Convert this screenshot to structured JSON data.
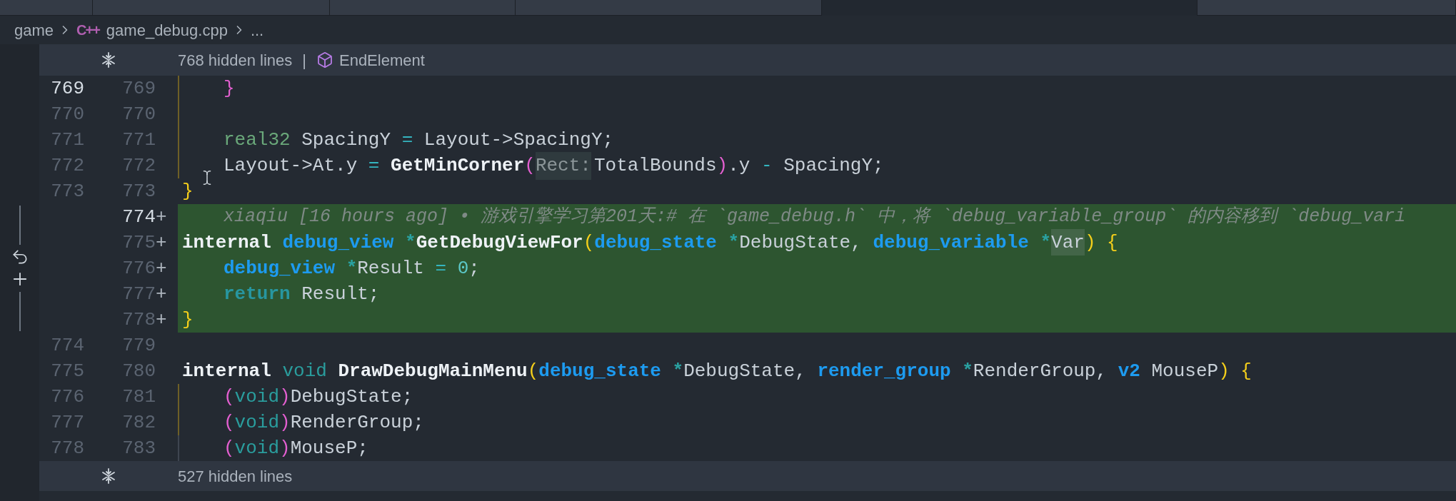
{
  "tabs": [
    {
      "selected": false
    },
    {
      "selected": false
    },
    {
      "selected": false
    },
    {
      "selected": false
    },
    {
      "selected": true
    },
    {
      "selected": false
    }
  ],
  "breadcrumb": {
    "folder": "game",
    "file_icon": "C++",
    "file": "game_debug.cpp",
    "symbol": "..."
  },
  "hidden_top": {
    "label": "768 hidden lines",
    "separator": "|",
    "symbol": "EndElement"
  },
  "lines": [
    {
      "old": {
        "text": "769",
        "active": true
      },
      "new": {
        "text": "769",
        "active": false
      },
      "added": false,
      "indented": true,
      "guide": true,
      "tokens": [
        {
          "text": "}",
          "kind": "paren_pink"
        }
      ]
    },
    {
      "old": {
        "text": "770",
        "active": false
      },
      "new": {
        "text": "770",
        "active": false
      },
      "added": false,
      "guide": true
    },
    {
      "old": {
        "text": "771",
        "active": false
      },
      "new": {
        "text": "771",
        "active": false
      },
      "added": false,
      "indented": true,
      "guide": true,
      "tokens": [
        {
          "text": "real32",
          "kind": "type"
        },
        {
          "text": " SpacingY ",
          "kind": "plain"
        },
        {
          "text": "=",
          "kind": "op"
        },
        {
          "text": " Layout->SpacingY;",
          "kind": "plain"
        }
      ]
    },
    {
      "old": {
        "text": "772",
        "active": false
      },
      "new": {
        "text": "772",
        "active": false
      },
      "added": false,
      "indented": true,
      "guide": true,
      "tokens": [
        {
          "text": "Layout->At.y ",
          "kind": "plain"
        },
        {
          "text": "= ",
          "kind": "op"
        },
        {
          "text": "GetMinCorner",
          "kind": "func"
        },
        {
          "text": "(",
          "kind": "paren_pink"
        },
        {
          "text": "Rect:",
          "kind": "hint"
        },
        {
          "text": "TotalBounds",
          "kind": "plain"
        },
        {
          "text": ")",
          "kind": "paren_pink"
        },
        {
          "text": ".y ",
          "kind": "plain"
        },
        {
          "text": "-",
          "kind": "op"
        },
        {
          "text": " SpacingY;",
          "kind": "plain"
        }
      ]
    },
    {
      "old": {
        "text": "773",
        "active": false
      },
      "new": {
        "text": "773",
        "active": false
      },
      "added": false,
      "indented": false,
      "pointer": true,
      "tokens": [
        {
          "text": "}",
          "kind": "paren_yellow"
        }
      ]
    },
    {
      "new": {
        "text": "774",
        "active": true
      },
      "marker": "+",
      "added": true,
      "indented": true,
      "tokens": [
        {
          "text": "xiaqiu [16 hours ago] • 游戏引擎学习第201天:# 在 `game_debug.h` 中，将 `debug_variable_group` 的内容移到 `debug_vari",
          "kind": "blame"
        }
      ]
    },
    {
      "new": {
        "text": "775",
        "active": false
      },
      "marker": "+",
      "added": true,
      "indented": false,
      "tokens": [
        {
          "text": "internal ",
          "kind": "keyword"
        },
        {
          "text": "debug_view ",
          "kind": "type_strong"
        },
        {
          "text": "*",
          "kind": "star"
        },
        {
          "text": "GetDebugViewFor",
          "kind": "func"
        },
        {
          "text": "(",
          "kind": "paren_yellow"
        },
        {
          "text": "debug_state ",
          "kind": "type_strong"
        },
        {
          "text": "*",
          "kind": "star"
        },
        {
          "text": "DebugState, ",
          "kind": "plain"
        },
        {
          "text": "debug_variable ",
          "kind": "type_strong"
        },
        {
          "text": "*",
          "kind": "star"
        },
        {
          "text": "Var",
          "kind": "highlight"
        },
        {
          "text": ") {",
          "kind": "paren_yellow"
        }
      ]
    },
    {
      "new": {
        "text": "776",
        "active": false
      },
      "marker": "+",
      "added": true,
      "indented": true,
      "tokens": [
        {
          "text": "debug_view ",
          "kind": "type_strong"
        },
        {
          "text": "*",
          "kind": "star"
        },
        {
          "text": "Result ",
          "kind": "plain"
        },
        {
          "text": "= ",
          "kind": "op"
        },
        {
          "text": "0",
          "kind": "number"
        },
        {
          "text": ";",
          "kind": "plain"
        }
      ]
    },
    {
      "new": {
        "text": "777",
        "active": false
      },
      "marker": "+",
      "added": true,
      "indented": true,
      "tokens": [
        {
          "text": "return",
          "kind": "return"
        },
        {
          "text": " Result;",
          "kind": "plain"
        }
      ]
    },
    {
      "new": {
        "text": "778",
        "active": false
      },
      "marker": "+",
      "added": true,
      "indented": false,
      "tokens": [
        {
          "text": "}",
          "kind": "paren_yellow"
        }
      ]
    },
    {
      "old": {
        "text": "774",
        "active": false
      },
      "new": {
        "text": "779",
        "active": false
      },
      "added": false
    },
    {
      "old": {
        "text": "775",
        "active": false
      },
      "new": {
        "text": "780",
        "active": false
      },
      "added": false,
      "indented": false,
      "tokens": [
        {
          "text": "internal ",
          "kind": "keyword"
        },
        {
          "text": "void ",
          "kind": "void"
        },
        {
          "text": "DrawDebugMainMenu",
          "kind": "func"
        },
        {
          "text": "(",
          "kind": "paren_yellow"
        },
        {
          "text": "debug_state ",
          "kind": "type_strong"
        },
        {
          "text": "*",
          "kind": "star"
        },
        {
          "text": "DebugState, ",
          "kind": "plain"
        },
        {
          "text": "render_group ",
          "kind": "type_strong"
        },
        {
          "text": "*",
          "kind": "star"
        },
        {
          "text": "RenderGroup, ",
          "kind": "plain"
        },
        {
          "text": "v2",
          "kind": "type_strong"
        },
        {
          "text": " MouseP",
          "kind": "plain"
        },
        {
          "text": ") {",
          "kind": "paren_yellow"
        }
      ]
    },
    {
      "old": {
        "text": "776",
        "active": false
      },
      "new": {
        "text": "781",
        "active": false
      },
      "added": false,
      "indented": true,
      "guide": true,
      "tokens": [
        {
          "text": "(",
          "kind": "paren_pink"
        },
        {
          "text": "void",
          "kind": "void"
        },
        {
          "text": ")",
          "kind": "paren_pink"
        },
        {
          "text": "DebugState;",
          "kind": "plain"
        }
      ]
    },
    {
      "old": {
        "text": "777",
        "active": false
      },
      "new": {
        "text": "782",
        "active": false
      },
      "added": false,
      "indented": true,
      "guide": true,
      "tokens": [
        {
          "text": "(",
          "kind": "paren_pink"
        },
        {
          "text": "void",
          "kind": "void"
        },
        {
          "text": ")",
          "kind": "paren_pink"
        },
        {
          "text": "RenderGroup;",
          "kind": "plain"
        }
      ]
    },
    {
      "old": {
        "text": "778",
        "active": false
      },
      "new": {
        "text": "783",
        "active": false
      },
      "added": false,
      "indented": true,
      "guide": false,
      "tokens": [
        {
          "text": "(",
          "kind": "paren_pink"
        },
        {
          "text": "void",
          "kind": "void"
        },
        {
          "text": ")",
          "kind": "paren_pink"
        },
        {
          "text": "MouseP;",
          "kind": "plain"
        }
      ]
    }
  ],
  "hidden_bottom": {
    "label": "527 hidden lines"
  }
}
